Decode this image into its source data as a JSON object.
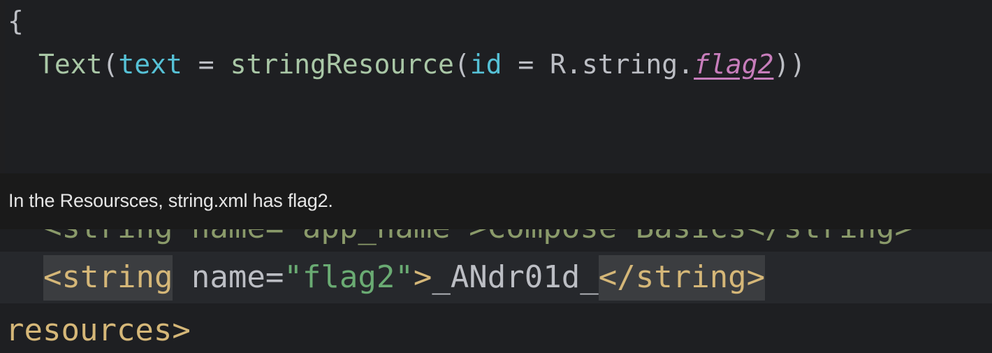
{
  "top_code": {
    "line1": "{",
    "line2": {
      "fn": "Text",
      "open": "(",
      "param1": "text",
      "eq1": " = ",
      "call": "stringResource",
      "open2": "(",
      "param2": "id",
      "eq2": " = ",
      "ref": "R.string.",
      "field": "flag2",
      "close": "))"
    }
  },
  "caption": "In the Resoursces, string.xml has flag2.",
  "bottom_code": {
    "partial_line": "<string name=\"app_name\">Compose Basics</string>",
    "flag_line": {
      "open_tag": "<string",
      "attr": " name=",
      "value": "\"flag2\"",
      "gt": ">",
      "text": "_ANdr01d_",
      "close_tag": "</string>"
    },
    "last_line": "resources>"
  }
}
